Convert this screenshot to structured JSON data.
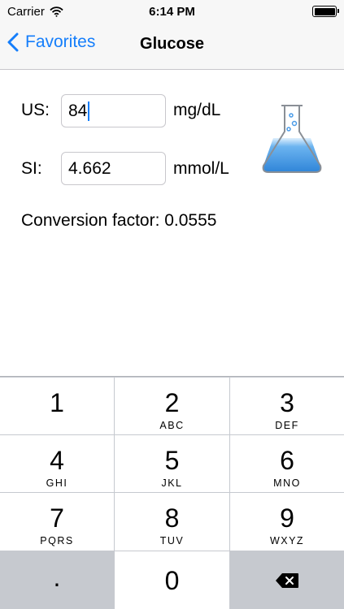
{
  "status_bar": {
    "carrier": "Carrier",
    "wifi_icon": "wifi-icon",
    "time": "6:14 PM",
    "battery_icon": "battery-icon"
  },
  "nav": {
    "back_label": "Favorites",
    "title": "Glucose"
  },
  "converter": {
    "us_label": "US:",
    "us_value": "84",
    "us_unit": "mg/dL",
    "si_label": "SI:",
    "si_value": "4.662",
    "si_unit": "mmol/L",
    "conversion_text": "Conversion factor: 0.0555",
    "illustration_icon": "flask-icon"
  },
  "keypad": {
    "keys": [
      {
        "num": "1",
        "letters": ""
      },
      {
        "num": "2",
        "letters": "ABC"
      },
      {
        "num": "3",
        "letters": "DEF"
      },
      {
        "num": "4",
        "letters": "GHI"
      },
      {
        "num": "5",
        "letters": "JKL"
      },
      {
        "num": "6",
        "letters": "MNO"
      },
      {
        "num": "7",
        "letters": "PQRS"
      },
      {
        "num": "8",
        "letters": "TUV"
      },
      {
        "num": "9",
        "letters": "WXYZ"
      }
    ],
    "decimal": ".",
    "zero": "0",
    "delete_icon": "backspace-icon"
  },
  "colors": {
    "accent": "#157efb",
    "keypad_bg": "#c6c9cf",
    "flask_liquid": "#6cb4f0"
  }
}
